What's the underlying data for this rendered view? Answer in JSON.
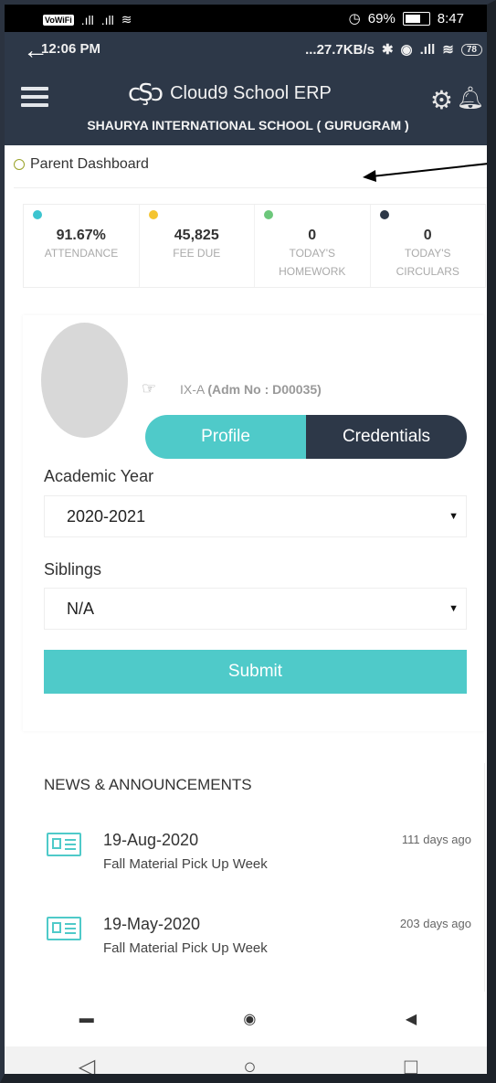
{
  "os_status": {
    "left_tag": "VoWiFi",
    "battery_pct": "69%",
    "time": "8:47"
  },
  "inner_status": {
    "time": "12:06 PM",
    "speed": "...27.7KB/s",
    "battery": "78"
  },
  "header": {
    "app_name": "Cloud9 School ERP",
    "school": "SHAURYA INTERNATIONAL SCHOOL ( GURUGRAM )"
  },
  "breadcrumb": {
    "label": "Parent Dashboard"
  },
  "stats": [
    {
      "value": "91.67%",
      "label": "ATTENDANCE",
      "color": "#3cc4cf"
    },
    {
      "value": "45,825",
      "label": "FEE DUE",
      "color": "#f4c430"
    },
    {
      "value": "0",
      "label": "TODAY'S HOMEWORK",
      "color": "#6cc77b"
    },
    {
      "value": "0",
      "label": "TODAY'S CIRCULARS",
      "color": "#2d3848"
    }
  ],
  "profile": {
    "class": "IX-A",
    "adm": "(Adm No : D00035)",
    "tab_profile": "Profile",
    "tab_credentials": "Credentials"
  },
  "form": {
    "academic_year_label": "Academic Year",
    "academic_year_value": "2020-2021",
    "siblings_label": "Siblings",
    "siblings_value": "N/A",
    "submit_label": "Submit"
  },
  "news": {
    "title": "NEWS & ANNOUNCEMENTS",
    "items": [
      {
        "date": "19-Aug-2020",
        "text": "Fall Material Pick Up Week",
        "ago": "111 days ago"
      },
      {
        "date": "19-May-2020",
        "text": "Fall Material Pick Up Week",
        "ago": "203 days ago"
      }
    ]
  },
  "colors": {
    "header_bg": "#2d3848",
    "accent": "#4fcac9"
  },
  "icons": [
    "back-arrow-icon",
    "menu-icon",
    "cloud-logo-icon",
    "settings-icon",
    "bell-icon",
    "hand-pointer-icon",
    "newspaper-icon"
  ]
}
